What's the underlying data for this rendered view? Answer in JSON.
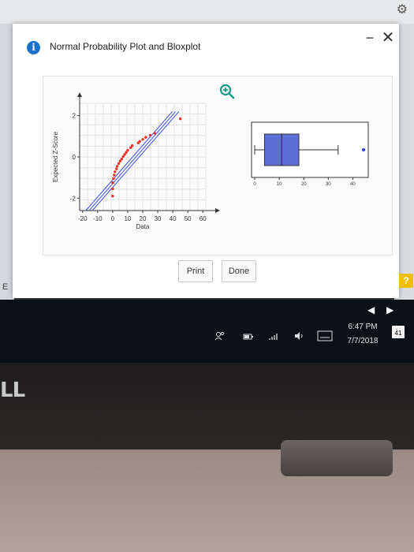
{
  "dialog": {
    "title": "Normal Probability Plot and Bloxplot",
    "minimize_glyph": "−",
    "close_glyph": "✕",
    "info_glyph": "i",
    "buttons": {
      "print": "Print",
      "done": "Done"
    }
  },
  "qq_plot": {
    "ylabel": "Expected Z-Score",
    "xlabel": "Data",
    "x_ticks": [
      -20,
      -10,
      0,
      10,
      20,
      30,
      40,
      50,
      60
    ],
    "y_ticks": [
      -2,
      0,
      2
    ],
    "xlim": [
      -22,
      62
    ],
    "ylim": [
      -2.6,
      2.6
    ],
    "point_color": "#e8312a",
    "line_color": "#3b4fd8",
    "fit_line": {
      "x_at_z0": 15.5,
      "slope_per_z": 12.0,
      "band_offset": 2.2
    },
    "points": [
      [
        0.0,
        -1.9
      ],
      [
        0.0,
        -1.55
      ],
      [
        0.0,
        -1.25
      ],
      [
        0.5,
        -1.05
      ],
      [
        1.0,
        -0.88
      ],
      [
        1.5,
        -0.72
      ],
      [
        2.5,
        -0.58
      ],
      [
        3.0,
        -0.45
      ],
      [
        4.0,
        -0.32
      ],
      [
        5.0,
        -0.2
      ],
      [
        6.0,
        -0.1
      ],
      [
        7.0,
        0.02
      ],
      [
        8.0,
        0.12
      ],
      [
        9.0,
        0.22
      ],
      [
        10.0,
        0.32
      ],
      [
        12.0,
        0.45
      ],
      [
        13.0,
        0.55
      ],
      [
        17.0,
        0.68
      ],
      [
        18.0,
        0.75
      ],
      [
        20.0,
        0.85
      ],
      [
        22.0,
        0.95
      ],
      [
        25.0,
        1.05
      ],
      [
        28.0,
        1.15
      ],
      [
        45.0,
        1.85
      ]
    ]
  },
  "box_plot": {
    "x_ticks": [
      0,
      10,
      20,
      30,
      40
    ],
    "xlim": [
      0,
      45
    ],
    "min": 0,
    "q1": 4,
    "median": 11,
    "q3": 18,
    "whisker_high": 34,
    "outlier": 45,
    "box_color": "#5b6fd6",
    "outlier_color": "#2a3fcf"
  },
  "taskbar": {
    "time": "6:47 PM",
    "date": "7/7/2018",
    "notification_count": "41",
    "nav_prev": "◀",
    "nav_next": "▶"
  },
  "misc": {
    "help_glyph": "?",
    "edge_letter": "E",
    "brand_text": "LL",
    "gear_glyph": "⚙"
  }
}
